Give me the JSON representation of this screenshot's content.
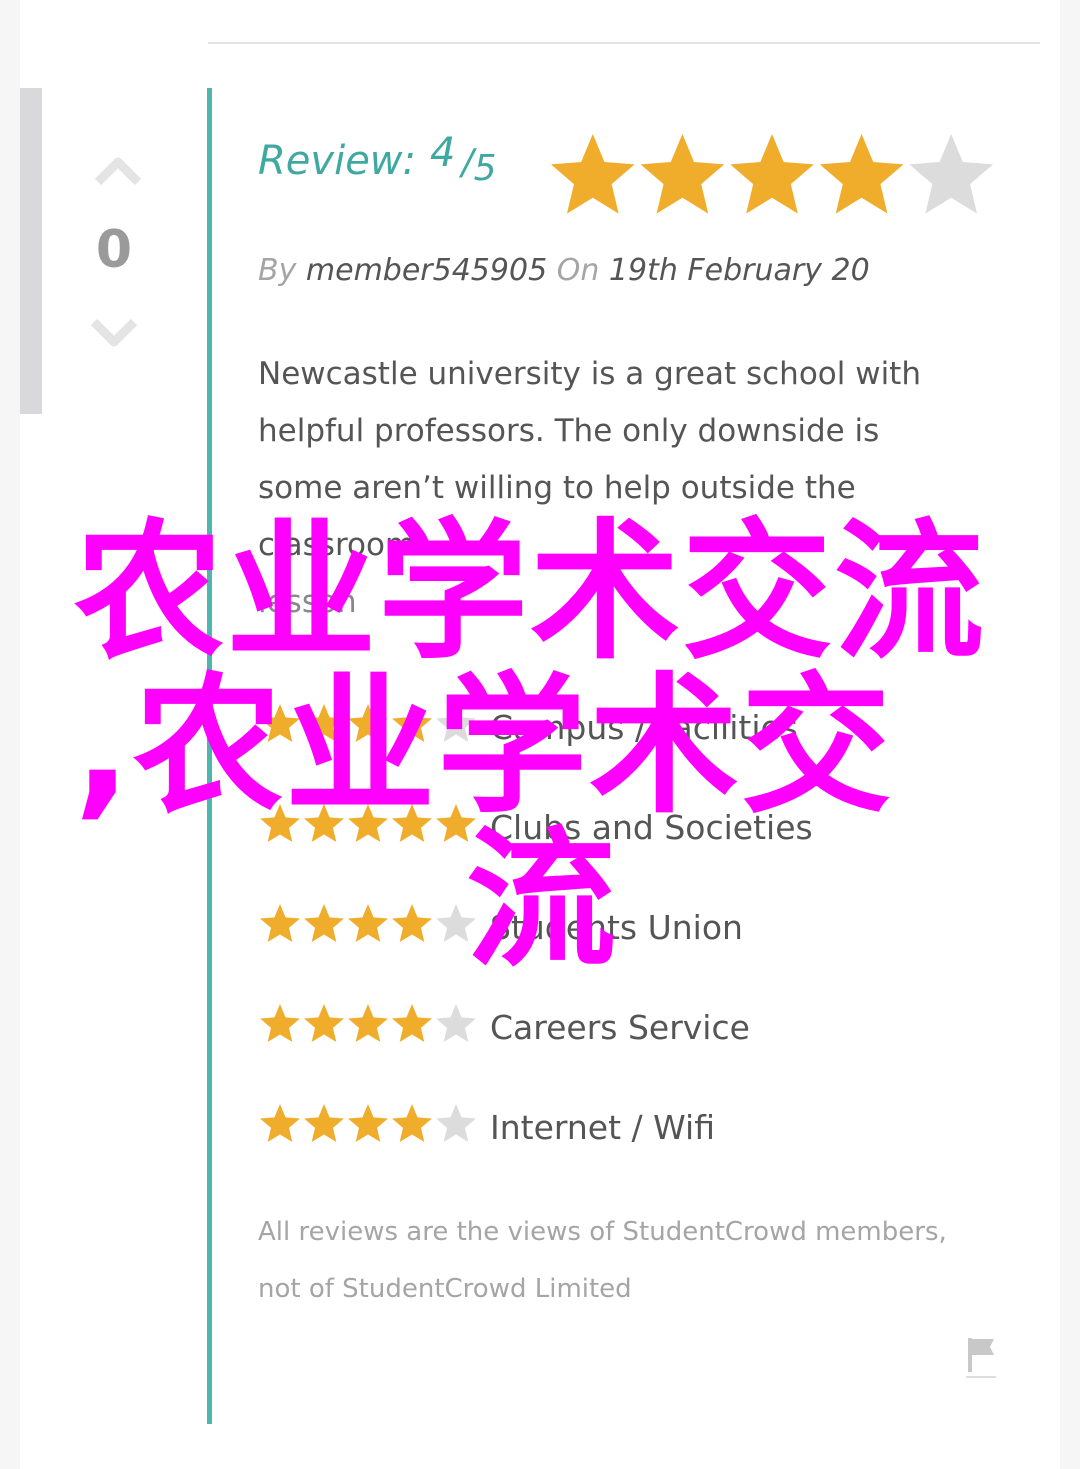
{
  "vote": {
    "count": "0"
  },
  "review": {
    "label": "Review:",
    "score": "4",
    "slash": "/",
    "max": "5",
    "stars": 4,
    "by_label": "By",
    "author": "member545905",
    "on_label": "On",
    "date": "19th February 20",
    "body_line1": "Newcastle university is a great school with",
    "body_line2": "helpful professors. The only downside is",
    "body_line3": "some aren’t willing to help outside the",
    "body_line4": "classroom",
    "body_line5": "lesson"
  },
  "ratings": [
    {
      "label": "Campus / Facilities",
      "stars": 4
    },
    {
      "label": "Clubs and Societies",
      "stars": 5
    },
    {
      "label": "Students Union",
      "stars": 4
    },
    {
      "label": "Careers Service",
      "stars": 4
    },
    {
      "label": "Internet / Wifi",
      "stars": 4
    }
  ],
  "disclaimer": {
    "line1": "All reviews are the views of StudentCrowd members,",
    "line2": "not of StudentCrowd Limited"
  },
  "overlay": {
    "line1": "农业学术交流",
    "line2": ",农业学术交",
    "line3": "流"
  },
  "icons": {
    "vote_up": "chevron-up-icon",
    "vote_down": "chevron-down-icon",
    "flag": "flag-icon",
    "star": "star-icon"
  },
  "colors": {
    "accent": "#3fa9a1",
    "star_filled": "#f0ad2c",
    "star_empty": "#dcdcdc",
    "overlay": "#ff00ff"
  }
}
